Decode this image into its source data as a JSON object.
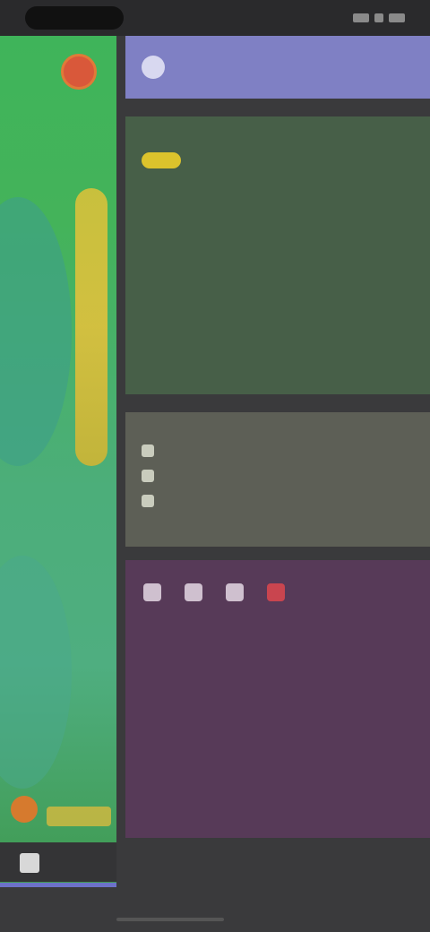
{
  "status": {
    "left_pill": "",
    "right": ""
  },
  "header": {
    "title": ""
  },
  "green_card": {
    "title": "",
    "badge": "",
    "badge_side": "",
    "row1_a": "",
    "row1_b": "",
    "row2_a": "",
    "row2_b": "",
    "note": "",
    "link": ""
  },
  "gray_card": {
    "title": "",
    "items": [
      {
        "label": "",
        "value": ""
      },
      {
        "label": "",
        "value": ""
      },
      {
        "label": "",
        "value": ""
      }
    ]
  },
  "purple_card": {
    "lines": [
      "",
      "",
      "",
      "",
      "",
      ""
    ]
  },
  "footer": {
    "note": ""
  },
  "icons": [
    "home-icon",
    "map-pin-icon"
  ],
  "colors": {
    "accent_purple": "#7f80c4",
    "badge_yellow": "#dcc32c",
    "highlight_red": "#c9454f"
  }
}
